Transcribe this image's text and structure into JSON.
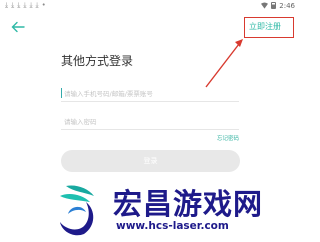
{
  "status_bar": {
    "time": "2:46",
    "notification_icons": [
      "download-icon",
      "download-icon",
      "download-icon",
      "download-icon",
      "download-icon",
      "download-icon",
      "dot-icon"
    ]
  },
  "header": {
    "register_label": "立即注册"
  },
  "login": {
    "title": "其他方式登录",
    "account_placeholder": "请输入手机号码/邮箱/票票账号",
    "password_placeholder": "请输入密码",
    "forgot_label": "忘记密码",
    "login_button": "登录"
  },
  "watermark": {
    "title": "宏昌游戏网",
    "url": "www.hcs-laser.com"
  },
  "colors": {
    "accent": "#2fb9a6",
    "highlight": "#d83a2f",
    "watermark": "#1e1a8a"
  }
}
